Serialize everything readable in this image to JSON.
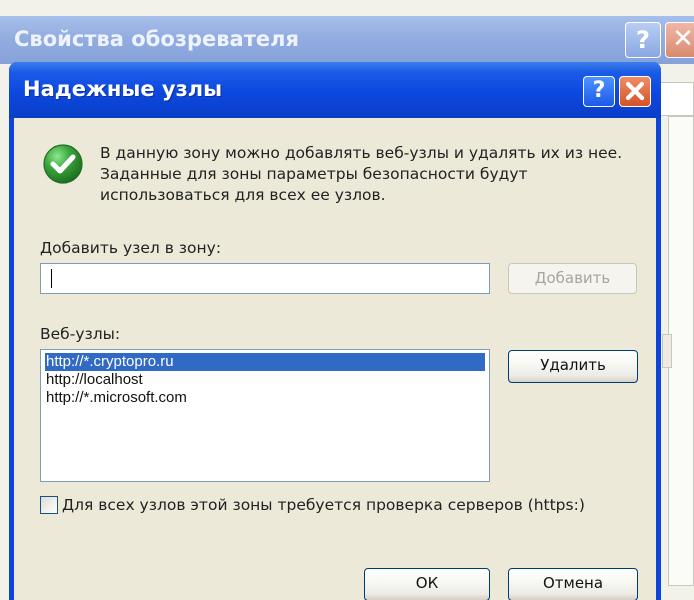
{
  "background_window": {
    "title": "Свойства обозревателя"
  },
  "dialog": {
    "title": "Надежные узлы",
    "help_symbol": "?",
    "info_text": "В данную зону можно добавлять веб-узлы и удалять их из нее. Заданные для зоны параметры безопасности будут использоваться для всех ее узлов."
  },
  "add_site": {
    "label": "Добавить узел  в зону:",
    "input_value": "",
    "button_label": "Добавить"
  },
  "web_sites": {
    "label": "Веб-узлы:",
    "items": [
      {
        "label": "http://*.cryptopro.ru",
        "selected": true
      },
      {
        "label": "http://localhost",
        "selected": false
      },
      {
        "label": "http://*.microsoft.com",
        "selected": false
      }
    ],
    "remove_button_label": "Удалить"
  },
  "https_check": {
    "label": "Для всех узлов этой зоны требуется проверка серверов (https:)",
    "checked": false
  },
  "footer": {
    "ok_label": "ОК",
    "cancel_label": "Отмена"
  },
  "colors": {
    "titlebar_blue": "#0c48df",
    "dialog_body": "#ece9d8",
    "selection_blue": "#316ac5",
    "close_red": "#d3532a",
    "check_green": "#2f9130"
  }
}
